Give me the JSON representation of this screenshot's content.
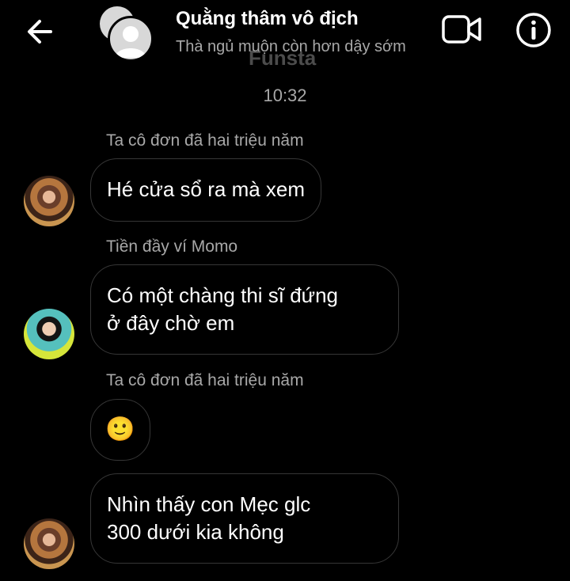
{
  "header": {
    "title": "Quằng thâm vô địch",
    "subtitle": "Thà ngủ muộn còn hơn dậy sớm",
    "watermark": "Funsta",
    "back_icon": "arrow-left-icon",
    "video_icon": "video-camera-icon",
    "info_icon": "info-circle-icon"
  },
  "timestamp": "10:32",
  "messages": [
    {
      "sender": "Ta cô đơn đã hai triệu năm",
      "lines": [
        "Hé cửa sổ ra mà xem"
      ]
    },
    {
      "sender": "Tiền đầy ví Momo",
      "lines": [
        "Có một chàng thi sĩ đứng",
        "ở đây chờ em"
      ]
    },
    {
      "sender": "Ta cô đơn đã hai triệu năm",
      "lines": [
        "🙂"
      ]
    },
    {
      "sender": "",
      "lines": [
        "Nhìn thấy con Mẹc glc",
        "300 dưới kia không"
      ]
    }
  ],
  "colors": {
    "background": "#000000",
    "bubble_border": "#363636",
    "muted_text": "#a8a8a8"
  }
}
